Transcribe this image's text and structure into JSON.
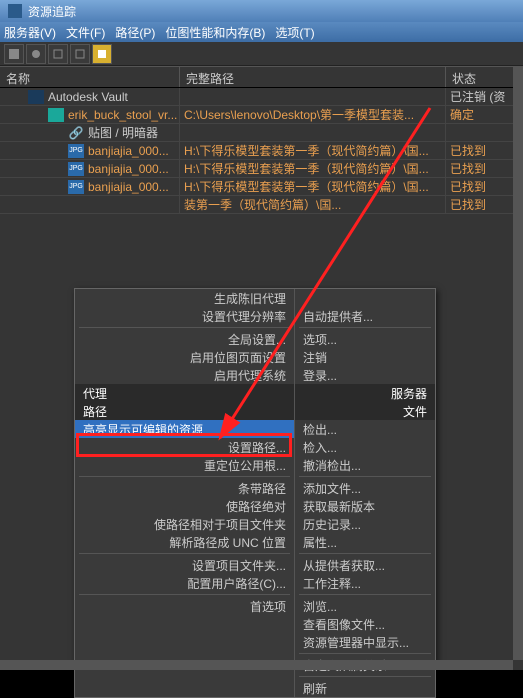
{
  "title": "资源追踪",
  "menu": {
    "server": "服务器(V)",
    "file": "文件(F)",
    "path": "路径(P)",
    "bitmap": "位图性能和内存(B)",
    "options": "选项(T)"
  },
  "headers": {
    "name": "名称",
    "path": "完整路径",
    "status": "状态"
  },
  "rows": [
    {
      "indent": 1,
      "icon": "vault",
      "name": "Autodesk Vault",
      "path": "",
      "status": "已注销 (资",
      "color": ""
    },
    {
      "indent": 2,
      "icon": "max",
      "name": "erik_buck_stool_vr...",
      "path": "C:\\Users\\lenovo\\Desktop\\第一季模型套装...",
      "status": "确定",
      "color": "o"
    },
    {
      "indent": 3,
      "icon": "link",
      "name": "贴图 / 明暗器",
      "path": "",
      "status": "",
      "color": ""
    },
    {
      "indent": 3,
      "icon": "jpg",
      "name": "banjiajia_000...",
      "path": "H:\\下得乐模型套装第一季（现代简约篇）\\国...",
      "status": "已找到",
      "color": "o"
    },
    {
      "indent": 3,
      "icon": "jpg",
      "name": "banjiajia_000...",
      "path": "H:\\下得乐模型套装第一季（现代简约篇）\\国...",
      "status": "已找到",
      "color": "o"
    },
    {
      "indent": 3,
      "icon": "jpg",
      "name": "banjiajia_000...",
      "path": "H:\\下得乐模型套装第一季（现代简约篇）\\国...",
      "status": "已找到",
      "color": "o"
    },
    {
      "indent": 3,
      "icon": "",
      "name": "",
      "path": "装第一季（现代简约篇）\\国...",
      "status": "已找到",
      "color": "o"
    }
  ],
  "ctx": {
    "left": [
      {
        "t": "生成陈旧代理",
        "r": true
      },
      {
        "t": "设置代理分辨率",
        "r": true
      },
      {
        "sep": true
      },
      {
        "t": "全局设置...",
        "r": true
      },
      {
        "t": "启用位图页面设置",
        "r": true
      },
      {
        "t": "启用代理系统",
        "r": true
      },
      {
        "t": "代理",
        "hdr": true
      },
      {
        "t": "路径",
        "hdr": true
      },
      {
        "t": "高亮显示可编辑的资源",
        "sel": true,
        "r": false
      },
      {
        "t": "设置路径...",
        "r": true
      },
      {
        "t": "重定位公用根...",
        "r": true
      },
      {
        "sep": true
      },
      {
        "t": "条带路径",
        "r": true
      },
      {
        "t": "使路径绝对",
        "r": true
      },
      {
        "t": "使路径相对于项目文件夹",
        "r": true
      },
      {
        "t": "解析路径成 UNC 位置",
        "r": true
      },
      {
        "sep": true
      },
      {
        "t": "设置项目文件夹...",
        "r": true
      },
      {
        "t": "配置用户路径(C)...",
        "r": true
      },
      {
        "sep": true
      },
      {
        "t": "首选项",
        "r": true
      }
    ],
    "right": [
      {
        "t": ""
      },
      {
        "t": "自动提供者..."
      },
      {
        "sep": true
      },
      {
        "t": "选项..."
      },
      {
        "t": "注销"
      },
      {
        "t": "登录..."
      },
      {
        "t": "服务器",
        "hdr": true,
        "r": true
      },
      {
        "t": "文件",
        "hdr": true,
        "r": true
      },
      {
        "t": "检出..."
      },
      {
        "t": "检入..."
      },
      {
        "t": "撤消检出..."
      },
      {
        "sep": true
      },
      {
        "t": "添加文件..."
      },
      {
        "t": "获取最新版本"
      },
      {
        "t": "历史记录..."
      },
      {
        "t": "属性..."
      },
      {
        "sep": true
      },
      {
        "t": "从提供者获取..."
      },
      {
        "t": "工作注释..."
      },
      {
        "sep": true
      },
      {
        "t": "浏览..."
      },
      {
        "t": "查看图像文件..."
      },
      {
        "t": "资源管理器中显示..."
      },
      {
        "sep": true
      },
      {
        "t": "自定义从属关系..."
      },
      {
        "sep": true
      },
      {
        "t": "刷新"
      }
    ]
  }
}
